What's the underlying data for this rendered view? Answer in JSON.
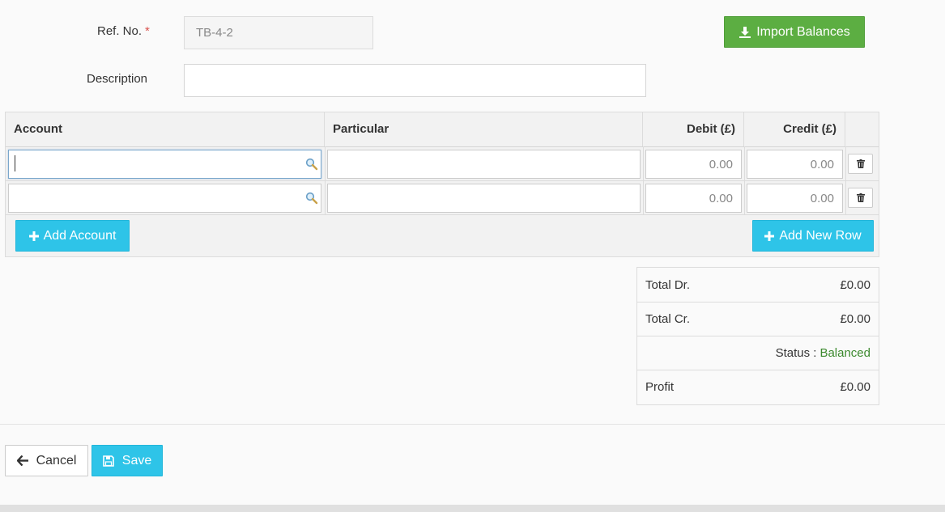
{
  "form": {
    "ref_label": "Ref. No.",
    "ref_required_mark": "*",
    "ref_value": "TB-4-2",
    "description_label": "Description",
    "description_value": ""
  },
  "import_button": {
    "label": "Import Balances",
    "icon": "download-icon",
    "color": "#5cae42"
  },
  "table": {
    "headers": {
      "account": "Account",
      "particular": "Particular",
      "debit": "Debit (£)",
      "credit": "Credit (£)"
    },
    "rows": [
      {
        "account": "",
        "particular": "",
        "debit": "0.00",
        "credit": "0.00"
      },
      {
        "account": "",
        "particular": "",
        "debit": "0.00",
        "credit": "0.00"
      }
    ],
    "add_account_label": "Add Account",
    "add_row_label": "Add New Row"
  },
  "totals": {
    "total_dr_label": "Total Dr.",
    "total_dr_value": "£0.00",
    "total_cr_label": "Total Cr.",
    "total_cr_value": "£0.00",
    "status_label": "Status :",
    "status_value": "Balanced",
    "profit_label": "Profit",
    "profit_value": "£0.00"
  },
  "actions": {
    "cancel_label": "Cancel",
    "save_label": "Save"
  },
  "colors": {
    "accent": "#2ec4e8",
    "success": "#3c8a2e",
    "required": "#d9534f"
  }
}
